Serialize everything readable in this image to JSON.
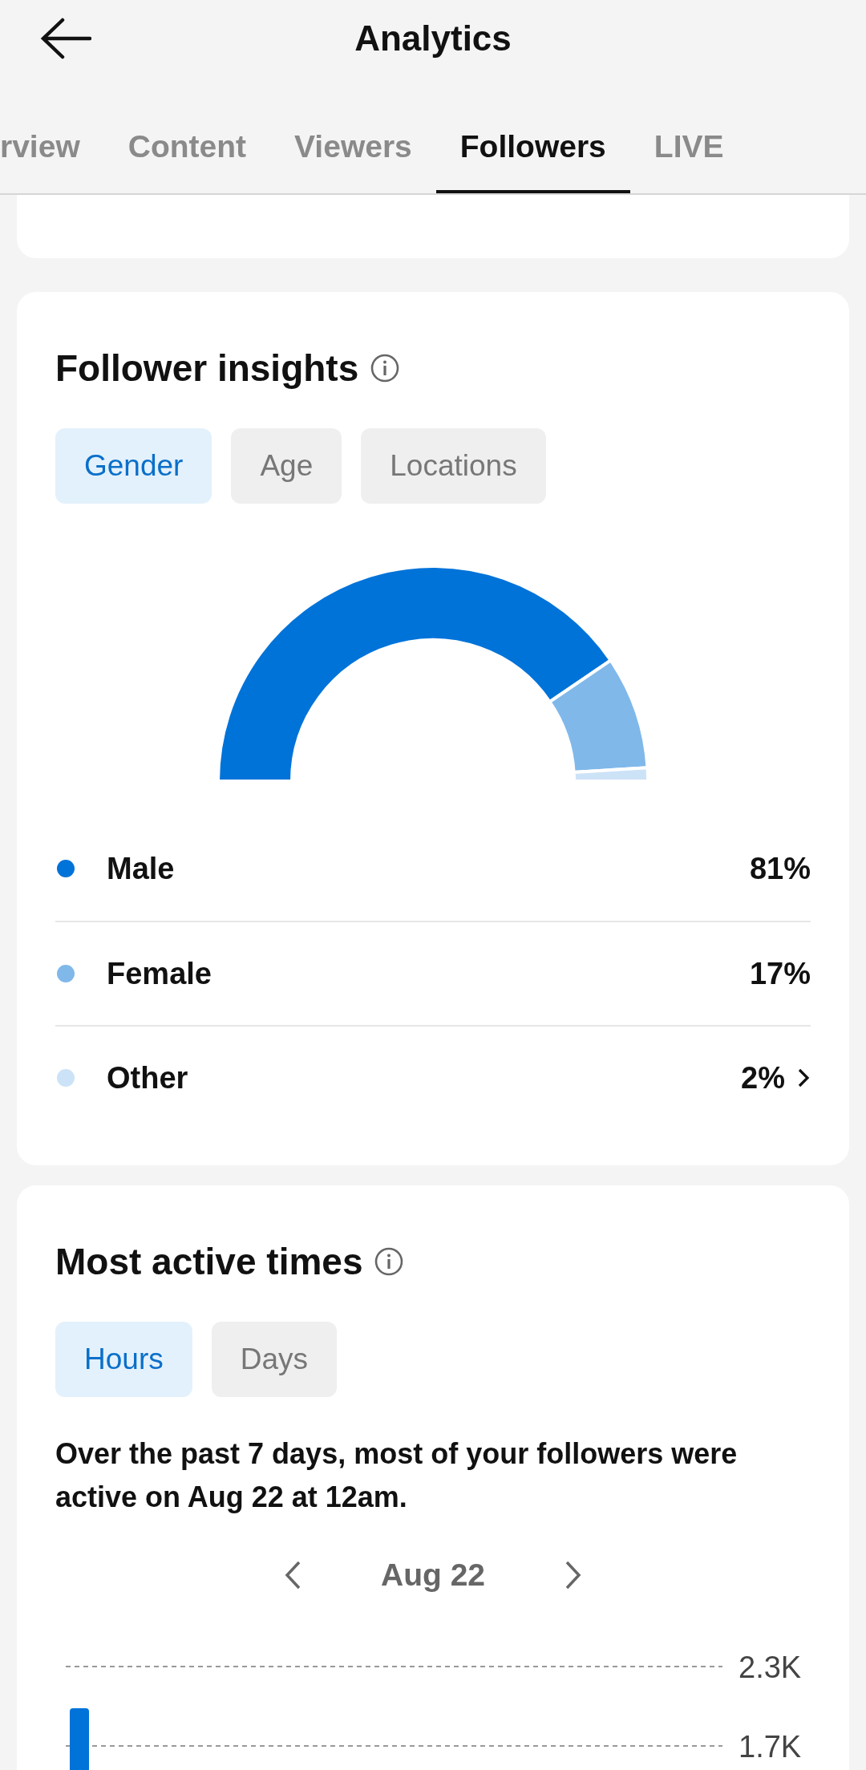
{
  "header": {
    "title": "Analytics"
  },
  "tabs": [
    {
      "label": "rview",
      "selected": false
    },
    {
      "label": "Content",
      "selected": false
    },
    {
      "label": "Viewers",
      "selected": false
    },
    {
      "label": "Followers",
      "selected": true
    },
    {
      "label": "LIVE",
      "selected": false
    }
  ],
  "follower_insights": {
    "title": "Follower insights",
    "filters": [
      {
        "label": "Gender",
        "selected": true
      },
      {
        "label": "Age",
        "selected": false
      },
      {
        "label": "Locations",
        "selected": false
      }
    ],
    "chart_data": {
      "type": "donut",
      "values": [
        81,
        17,
        2
      ]
    },
    "legend": [
      {
        "label": "Male",
        "percent": "81%",
        "color": "#0073d9",
        "expandable": false
      },
      {
        "label": "Female",
        "percent": "17%",
        "color": "#80b8ea",
        "expandable": false
      },
      {
        "label": "Other",
        "percent": "2%",
        "color": "#cce2f7",
        "expandable": true
      }
    ]
  },
  "most_active_times": {
    "title": "Most active times",
    "filters": [
      {
        "label": "Hours",
        "selected": true
      },
      {
        "label": "Days",
        "selected": false
      }
    ],
    "summary": "Over the past 7 days, most of your followers were active on Aug 22 at 12am.",
    "date": "Aug 22",
    "axis_labels": [
      "2.3K",
      "1.7K"
    ]
  }
}
